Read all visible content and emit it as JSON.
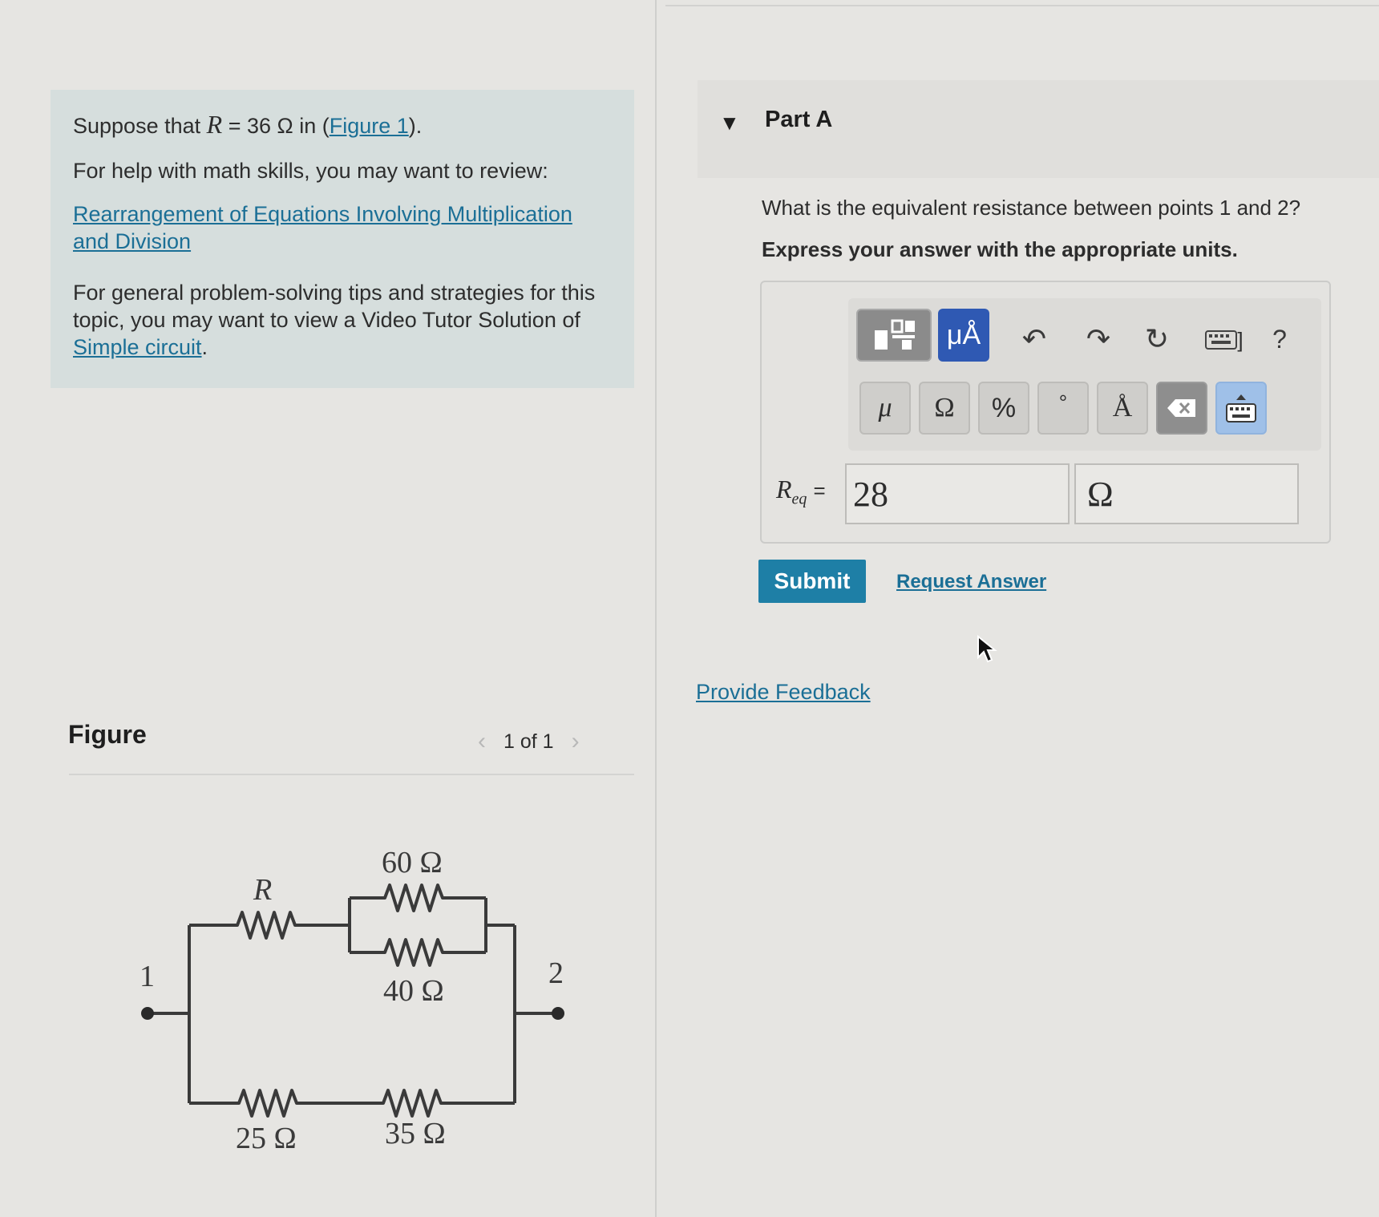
{
  "problem": {
    "intro_prefix": "Suppose that",
    "intro_var": "R",
    "intro_equals": "= 36 Ω in (",
    "intro_link": "Figure 1",
    "intro_suffix": ").",
    "help_text": "For help with math skills, you may want to review:",
    "help_link": "Rearrangement of Equations Involving Multiplication and Division",
    "tips_text": "For general problem-solving tips and strategies for this topic, you may want to view a Video Tutor Solution of",
    "tips_link": "Simple circuit",
    "tips_suffix": "."
  },
  "figure": {
    "title": "Figure",
    "pager": "1 of 1",
    "prev_icon": "chevron-left-icon",
    "next_icon": "chevron-right-icon",
    "labels": {
      "r": "R",
      "r60": "60 Ω",
      "r40": "40 Ω",
      "r25": "25 Ω",
      "r35": "35 Ω",
      "node1": "1",
      "node2": "2"
    }
  },
  "part": {
    "title": "Part A",
    "question": "What is the equivalent resistance between points 1 and 2?",
    "instruction": "Express your answer with the appropriate units."
  },
  "toolbar": {
    "units_label": "μÅ",
    "help_label": "?",
    "keyboard_suffix": "]",
    "icons": [
      "templates-icon",
      "undo-icon",
      "redo-icon",
      "reset-icon",
      "keyboard-icon",
      "help-icon"
    ]
  },
  "symbols": {
    "mu": "μ",
    "ohm": "Ω",
    "percent": "%",
    "degree": "°",
    "angstrom": "Å"
  },
  "answer": {
    "label_var": "R",
    "label_sub": "eq",
    "label_eq": "=",
    "value": "28",
    "unit": "Ω"
  },
  "actions": {
    "submit": "Submit",
    "request": "Request Answer",
    "feedback": "Provide Feedback"
  },
  "colors": {
    "link": "#1b6f96",
    "submit_bg": "#1e7fa6",
    "units_btn": "#2f59b3",
    "info_bg": "#d6dedd"
  }
}
